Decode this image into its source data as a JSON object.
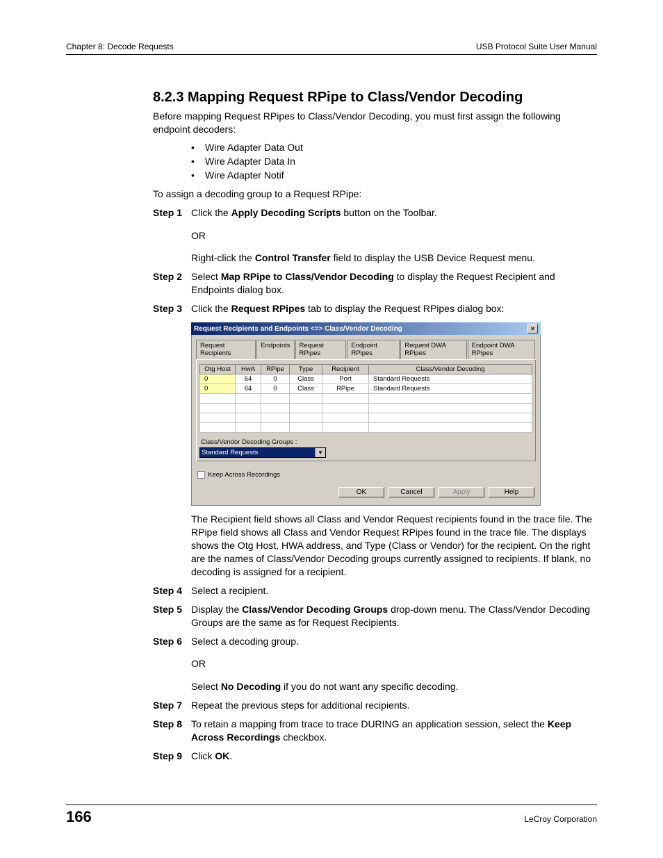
{
  "header": {
    "left": "Chapter 8: Decode Requests",
    "right": "USB Protocol Suite User Manual"
  },
  "section": {
    "title": "8.2.3 Mapping Request RPipe to Class/Vendor Decoding",
    "intro": "Before mapping Request RPipes to Class/Vendor Decoding, you must first assign the following endpoint decoders:",
    "bullets": [
      "Wire Adapter Data Out",
      "Wire Adapter Data In",
      "Wire Adapter Notif"
    ],
    "intro2": "To assign a decoding group to a Request RPipe:"
  },
  "steps": {
    "s1_label": "Step 1",
    "s1_a": "Click the ",
    "s1_b": "Apply Decoding Scripts",
    "s1_c": " button on the Toolbar.",
    "s1_or": "OR",
    "s1_d": "Right-click the ",
    "s1_e": "Control Transfer",
    "s1_f": " field to display the USB Device Request menu.",
    "s2_label": "Step 2",
    "s2_a": "Select ",
    "s2_b": "Map RPipe to Class/Vendor Decoding",
    "s2_c": " to display the Request Recipient and Endpoints dialog box.",
    "s3_label": "Step 3",
    "s3_a": "Click the ",
    "s3_b": "Request RPipes",
    "s3_c": " tab to display the Request RPipes dialog box:",
    "post_dialog": "The Recipient field shows all Class and Vendor Request recipients found in the trace file. The RPipe field shows all Class and Vendor Request RPipes found in the trace file. The displays shows the Otg Host, HWA address, and Type (Class or Vendor) for the recipient. On the right are the names of Class/Vendor Decoding groups currently assigned to recipients. If blank, no decoding is assigned for a recipient.",
    "s4_label": "Step 4",
    "s4": "Select a recipient.",
    "s5_label": "Step 5",
    "s5_a": "Display the ",
    "s5_b": "Class/Vendor Decoding Groups",
    "s5_c": " drop-down menu. The Class/Vendor Decoding Groups are the same as for Request Recipients.",
    "s6_label": "Step 6",
    "s6_a": "Select a decoding group.",
    "s6_or": "OR",
    "s6_b": "Select ",
    "s6_c": "No Decoding",
    "s6_d": " if you do not want any specific decoding.",
    "s7_label": "Step 7",
    "s7": "Repeat the previous steps for additional recipients.",
    "s8_label": "Step 8",
    "s8_a": "To retain a mapping from trace to trace DURING an application session, select the ",
    "s8_b": "Keep Across Recordings",
    "s8_c": " checkbox.",
    "s9_label": "Step 9",
    "s9_a": "Click ",
    "s9_b": "OK",
    "s9_c": "."
  },
  "dialog": {
    "title": "Request Recipients and Endpoints <=> Class/Vendor Decoding",
    "tabs": [
      "Request Recipients",
      "Endpoints",
      "Request RPipes",
      "Endpoint RPipes",
      "Request DWA RPipes",
      "Endpoint DWA RPipes"
    ],
    "active_tab_index": 2,
    "columns": [
      "Otg Host",
      "HwA",
      "RPipe",
      "Type",
      "Recipient",
      "Class/Vendor Decoding"
    ],
    "rows": [
      {
        "otg": "0",
        "hwa": "64",
        "rpipe": "0",
        "type": "Class",
        "recipient": "Port",
        "decoding": "Standard Requests"
      },
      {
        "otg": "0",
        "hwa": "64",
        "rpipe": "0",
        "type": "Class",
        "recipient": "RPipe",
        "decoding": "Standard Requests"
      }
    ],
    "groups_label": "Class/Vendor Decoding Groups :",
    "combo_value": "Standard Requests",
    "keep_label": "Keep Across Recordings",
    "buttons": {
      "ok": "OK",
      "cancel": "Cancel",
      "apply": "Apply",
      "help": "Help"
    }
  },
  "footer": {
    "page": "166",
    "corp": "LeCroy Corporation"
  }
}
